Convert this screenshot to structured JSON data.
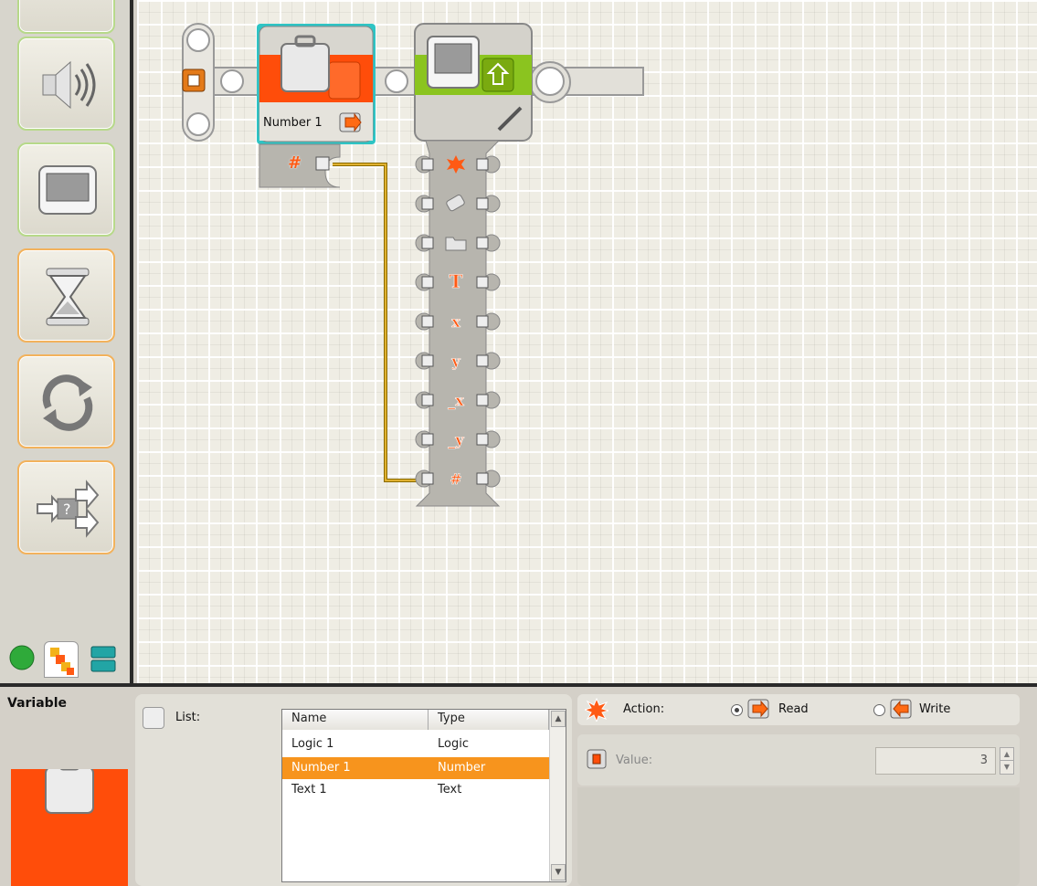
{
  "palette": {
    "items": [
      {
        "name": "sound-block"
      },
      {
        "name": "display-block"
      },
      {
        "name": "wait-block"
      },
      {
        "name": "loop-block"
      },
      {
        "name": "switch-block"
      }
    ],
    "tabs": [
      "common-palette",
      "complete-palette",
      "custom-palette"
    ]
  },
  "canvas": {
    "variable_block": {
      "label": "Number 1",
      "plug_symbol": "#"
    },
    "display_block": {
      "plugs": [
        "action",
        "clear",
        "file",
        "T",
        "x",
        "y",
        "_x",
        "_y",
        "#"
      ]
    }
  },
  "config": {
    "title": "Variable",
    "list_label": "List:",
    "columns": [
      "Name",
      "Type"
    ],
    "rows": [
      {
        "name": "Logic 1",
        "type": "Logic",
        "selected": false
      },
      {
        "name": "Number 1",
        "type": "Number",
        "selected": true
      },
      {
        "name": "Text 1",
        "type": "Text",
        "selected": false
      }
    ],
    "action_label": "Action:",
    "read_label": "Read",
    "write_label": "Write",
    "action_selected": "Read",
    "value_label": "Value:",
    "value": "3"
  },
  "colors": {
    "accent": "#ff4d0a",
    "selection": "#f7941d",
    "selected_block_outline": "#2ec4c4",
    "wire": "#d8a01a"
  }
}
